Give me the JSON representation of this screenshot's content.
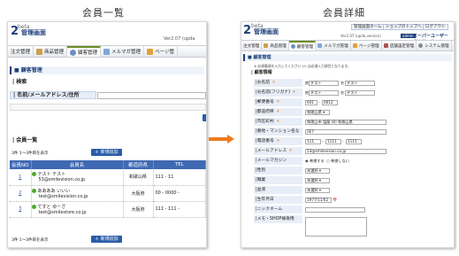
{
  "captions": {
    "left": "会員一覧",
    "right": "会員詳細"
  },
  "left": {
    "logo_num": "2",
    "beta": "beta",
    "title": "管理画面",
    "version": "Ver2.07 (upda",
    "nav": [
      "注文管理",
      "商品管理",
      "顧客管理",
      "メルマガ管理",
      "ページ管"
    ],
    "section_title": "顧客管理",
    "search_label": "検索",
    "search_field_label": "名前/メールアドレス/住所",
    "list_title": "会員一覧",
    "count_text": "3件 1～3件目を表示",
    "new_button": "新規追加",
    "table": {
      "headers": [
        "会員NO",
        "会員名",
        "都道府県",
        "TEL"
      ],
      "rows": [
        {
          "id": "1",
          "name": "テスト テスト",
          "email": "53@smilevision.co.jp",
          "pref": "和歌山県",
          "tel": "111 - 11"
        },
        {
          "id": "2",
          "name": "ああああ いいい",
          "email": "test@smilevision.co.jp",
          "pref": "大阪府",
          "tel": "00 - 0000 -"
        },
        {
          "id": "3",
          "name": "てすと ゆーざ",
          "email": "test@smilestore.co.jp",
          "pref": "大阪府",
          "tel": "111 - 111 -"
        }
      ]
    }
  },
  "right": {
    "logo_num": "2",
    "beta": "beta",
    "title": "管理画面",
    "header_buttons": [
      "管理画面ホーム",
      "ショップのトップへ",
      "ログアウト"
    ],
    "version": "Ver2.07 (upda.version)",
    "badge": "admin",
    "user": "スーパーユーザー 様ようこそ",
    "nav": [
      "注文管理",
      "商品管理",
      "顧客管理",
      "メルマガ管理",
      "ページ管理",
      "店舗設定管理",
      "システム管理"
    ],
    "section_title": "顧客管理",
    "note": "※ 必須事項を入力してください (*) は必須入力項目となります。",
    "info_title": "顧客情報",
    "fields": [
      {
        "label": "お名前",
        "req": true,
        "values": [
          "姓",
          "テスト",
          "名",
          "テスト"
        ]
      },
      {
        "label": "お名前(フリガナ)",
        "req": true,
        "values": [
          "姓",
          "テスト",
          "名",
          "テスト"
        ]
      },
      {
        "label": "郵便番号",
        "req": true,
        "values": [
          "641",
          "-",
          "0012"
        ]
      },
      {
        "label": "都道府県",
        "req": true,
        "values": [
          "和歌山県"
        ]
      },
      {
        "label": "市区町村",
        "req": true,
        "values": [
          "和歌山市 塩屋 (8) 和歌山県"
        ]
      },
      {
        "label": "番地・マンション名など",
        "req": true,
        "values": [
          "2E7"
        ]
      },
      {
        "label": "電話番号",
        "req": true,
        "values": [
          "111",
          "-",
          "1111",
          "-",
          "1111"
        ]
      },
      {
        "label": "メールアドレス",
        "req": true,
        "values": [
          "53@smilevision.co.jp"
        ]
      },
      {
        "label": "メールマガジン",
        "req": false,
        "values": [
          "希望する",
          "希望しない"
        ]
      },
      {
        "label": "性別",
        "req": false,
        "values": [
          "未選択"
        ]
      },
      {
        "label": "職業",
        "req": false,
        "values": [
          "未選択"
        ]
      },
      {
        "label": "血液",
        "req": false,
        "values": [
          "未選択"
        ]
      },
      {
        "label": "生年月日",
        "req": false,
        "values": [
          "1977/11/02"
        ]
      },
      {
        "label": "ニックネーム",
        "req": false,
        "values": [
          ""
        ]
      },
      {
        "label": "メモ・SHOP様専用",
        "req": false,
        "values": [
          ""
        ]
      }
    ]
  },
  "colors": {
    "accent": "#1b3e7a",
    "arrow": "#f07a1b",
    "table_head": "#3f69b3"
  }
}
